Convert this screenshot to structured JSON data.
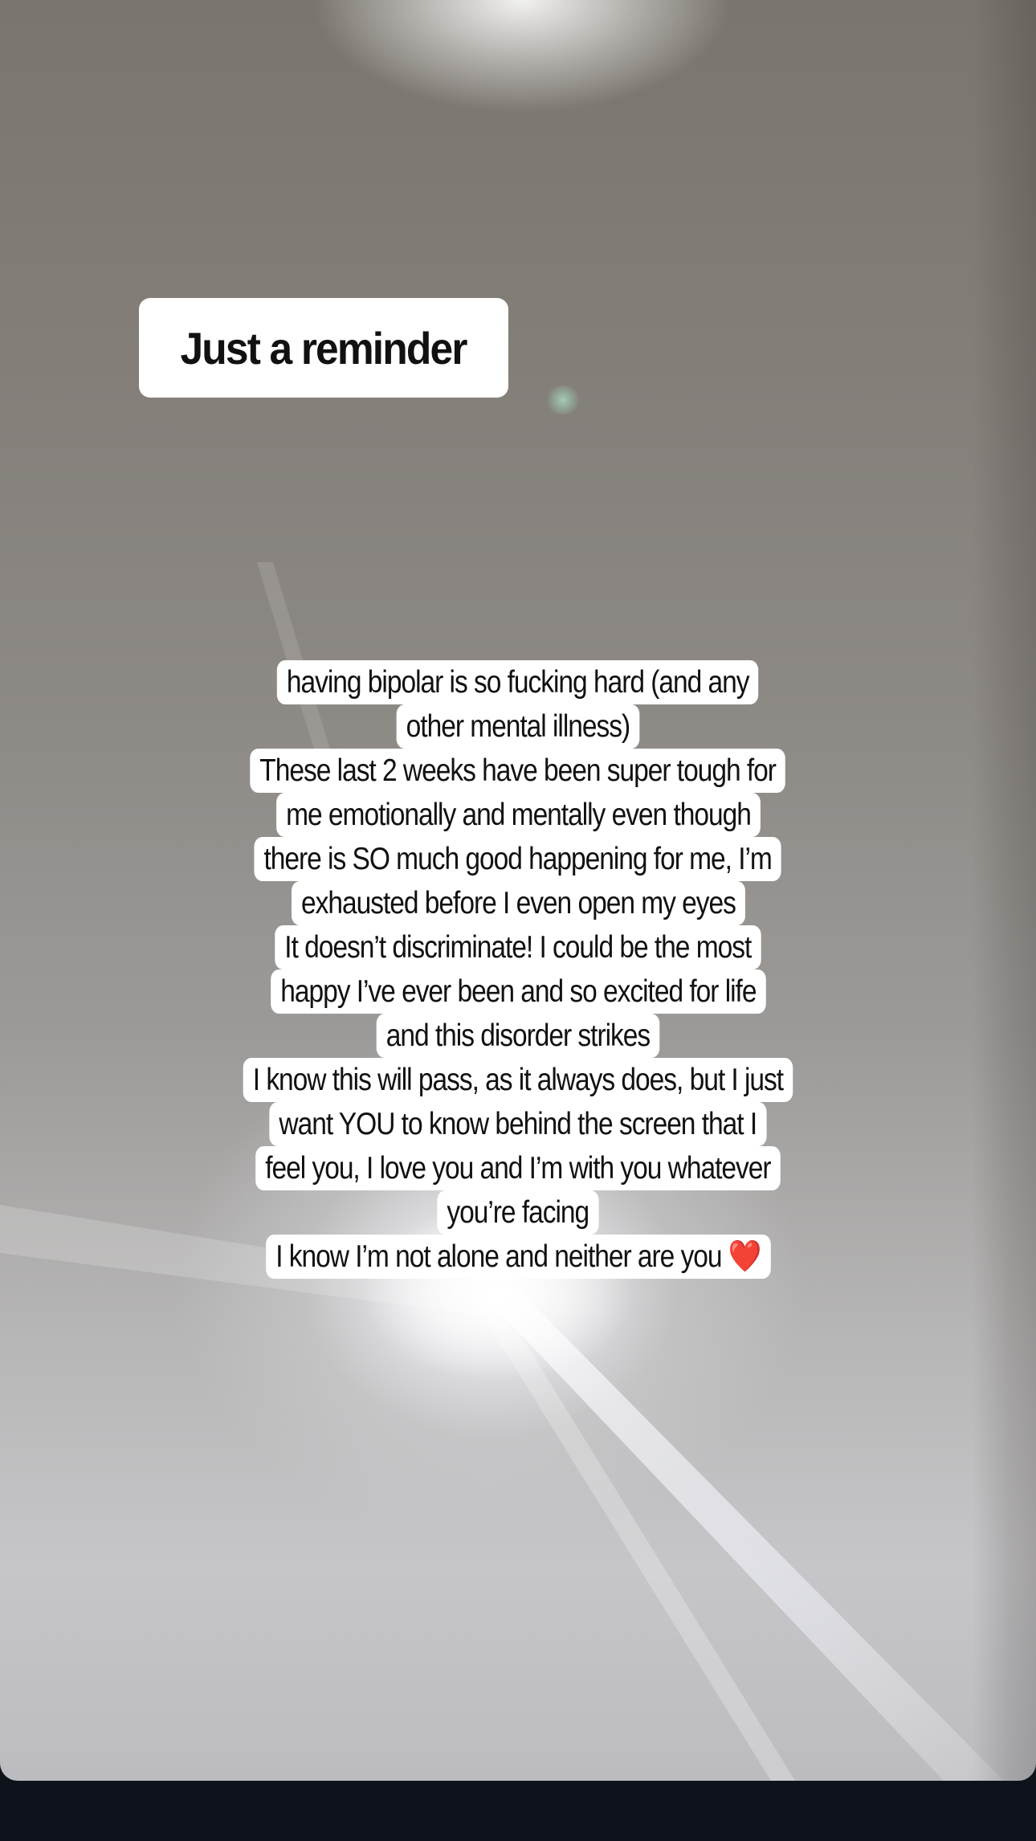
{
  "story": {
    "title": "Just a reminder",
    "lines": [
      "having bipolar is so fucking hard (and any",
      "other mental illness)",
      "These last 2 weeks have been super tough for",
      "me emotionally and mentally even though",
      "there is SO much good happening for me, I’m",
      "exhausted before I even open my eyes",
      "It doesn’t discriminate! I could be the most",
      "happy I’ve ever been and so excited for life",
      "and this disorder strikes",
      "I know this will pass, as it always does, but I just",
      "want YOU to know behind the screen that I",
      "feel you, I love you and I’m with you whatever",
      "you’re facing",
      "I know I’m not alone and neither are you"
    ],
    "last_line_emoji": "❤️"
  },
  "colors": {
    "sticker_bg": "#ffffff",
    "text": "#111111",
    "bottom_bar": "#0d121b",
    "heart": "#e0202a"
  },
  "icons": {
    "heart": "red-heart-emoji"
  }
}
